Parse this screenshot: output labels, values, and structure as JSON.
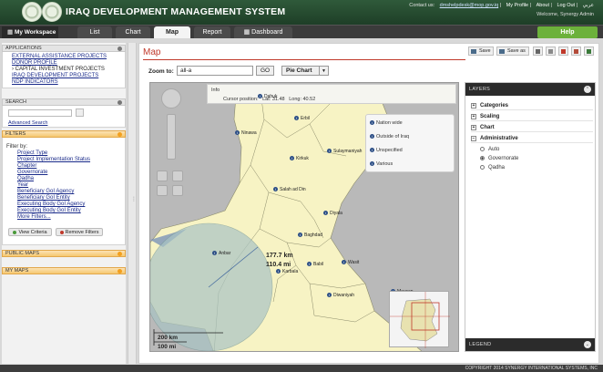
{
  "header": {
    "title": "IRAQ DEVELOPMENT MANAGEMENT SYSTEM",
    "contact_label": "Contact us:",
    "contact_email": "dmshelpdesk@mop.gov.iq",
    "links": [
      "My Profile",
      "About",
      "Log Out",
      "عربي"
    ],
    "welcome": "Welcome, Synergy Admin"
  },
  "tabs": {
    "workspace": "My Workspace",
    "items": [
      "List",
      "Chart",
      "Map",
      "Report",
      "Dashboard"
    ],
    "active": "Map",
    "help": "Help"
  },
  "sidebar": {
    "applications": {
      "title": "APPLICATIONS",
      "items": [
        "EXTERNAL ASSISTANCE PROJECTS",
        "DONOR PROFILE",
        "CAPITAL INVESTMENT PROJECTS",
        "IRAQ DEVELOPMENT PROJECTS",
        "NDP INDICATORS"
      ]
    },
    "search": {
      "title": "SEARCH",
      "advanced": "Advanced Search"
    },
    "filters": {
      "title": "FILTERS",
      "filter_by": "Filter by:",
      "items": [
        "Project Type",
        "Project Implementation Status",
        "Chapter",
        "Governorate",
        "Qadha",
        "Year",
        "Beneficiary GoI Agency",
        "Beneficiary GoI Entity",
        "Executing Body GoI Agency",
        "Executing Body GoI Entity",
        "More Filters..."
      ],
      "view_criteria": "View Criteria",
      "remove_filters": "Remove Filters"
    },
    "public_maps": "PUBLIC MAPS",
    "my_maps": "MY MAPS"
  },
  "main": {
    "title": "Map",
    "toolbar": {
      "save": "Save",
      "save_as": "Save as"
    },
    "zoom_label": "Zoom to:",
    "zoom_value": "all-a",
    "go": "GO",
    "chart_type": "Pie Chart"
  },
  "map": {
    "info_title": "Info",
    "cursor_label": "Cursor position:",
    "lat_label": "Lat:",
    "lat": "31.48",
    "long_label": "Long:",
    "long": "40.52",
    "legend": [
      "Nation wide",
      "Outside of Iraq",
      "Unspecified",
      "Various"
    ],
    "cities": [
      "Dahuk",
      "Erbil",
      "Ninawa",
      "Sulaymaniyah",
      "Kirkuk",
      "Salah ad Din",
      "Diyala",
      "Baghdad",
      "Anbar",
      "Babil",
      "Wasit",
      "Karbala",
      "Diwaniyah",
      "Maysan"
    ],
    "measure_km": "177.7 km",
    "measure_mi": "110.4 mi",
    "scale_km": "200 km",
    "scale_mi": "100 mi"
  },
  "layers": {
    "title": "LAYERS",
    "groups": [
      "Categories",
      "Scaling",
      "Chart",
      "Administrative"
    ],
    "admin_options": [
      "Auto",
      "Governorate",
      "Qadha"
    ],
    "admin_selected": "Governorate",
    "legend_title": "LEGEND"
  },
  "footer": "COPYRIGHT 2014 SYNERGY INTERNATIONAL SYSTEMS, INC",
  "colors": {
    "header": "#2f5a3a",
    "accent": "#c0392b",
    "help": "#6cb13b",
    "map_land": "#f7f3c4",
    "map_bg": "#b9b9b9"
  }
}
